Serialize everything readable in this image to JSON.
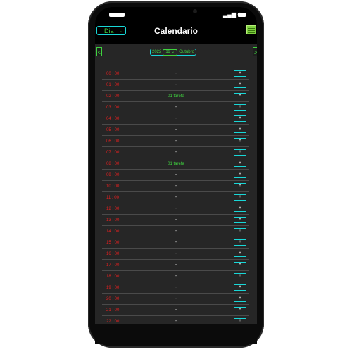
{
  "header": {
    "view_select": "Dia",
    "title": "Calendario"
  },
  "icons": {
    "view_chevron": "chevron-down-icon",
    "calendar": "calendar-icon",
    "prev": "chevron-left-icon",
    "next": "chevron-right-icon"
  },
  "nav": {
    "prev_label": "<",
    "next_label": ">",
    "year": "2022",
    "day": "11",
    "month": "Outubro"
  },
  "rows": [
    {
      "hour": "00 : 00",
      "task": "-",
      "add": "+"
    },
    {
      "hour": "01 : 00",
      "task": "-",
      "add": "+"
    },
    {
      "hour": "02 : 00",
      "task": "01 tarefa",
      "add": "+"
    },
    {
      "hour": "03 : 00",
      "task": "-",
      "add": "+"
    },
    {
      "hour": "04 : 00",
      "task": "-",
      "add": "+"
    },
    {
      "hour": "05 : 00",
      "task": "-",
      "add": "+"
    },
    {
      "hour": "06 : 00",
      "task": "-",
      "add": "+"
    },
    {
      "hour": "07 : 00",
      "task": "-",
      "add": "+"
    },
    {
      "hour": "08 : 00",
      "task": "01 tarefa",
      "add": "+"
    },
    {
      "hour": "09 : 00",
      "task": "-",
      "add": "+"
    },
    {
      "hour": "10 : 00",
      "task": "-",
      "add": "+"
    },
    {
      "hour": "11 : 00",
      "task": "-",
      "add": "+"
    },
    {
      "hour": "12 : 00",
      "task": "-",
      "add": "+"
    },
    {
      "hour": "13 : 00",
      "task": "-",
      "add": "+"
    },
    {
      "hour": "14 : 00",
      "task": "-",
      "add": "+"
    },
    {
      "hour": "15 : 00",
      "task": "-",
      "add": "+"
    },
    {
      "hour": "16 : 00",
      "task": "-",
      "add": "+"
    },
    {
      "hour": "17 : 00",
      "task": "-",
      "add": "+"
    },
    {
      "hour": "18 : 00",
      "task": "-",
      "add": "+"
    },
    {
      "hour": "19 : 00",
      "task": "-",
      "add": "+"
    },
    {
      "hour": "20 : 00",
      "task": "-",
      "add": "+"
    },
    {
      "hour": "21 : 00",
      "task": "-",
      "add": "+"
    },
    {
      "hour": "22 : 00",
      "task": "-",
      "add": "+"
    }
  ],
  "colors": {
    "hour": "#e02020",
    "task_has": "#3fd33f",
    "accent": "#18d7d7",
    "background": "#262626"
  }
}
